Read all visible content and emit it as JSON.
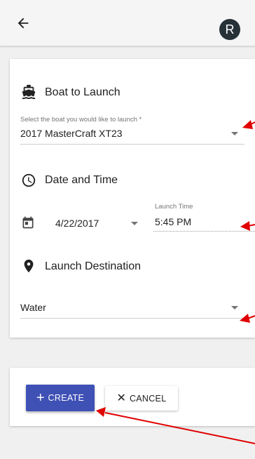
{
  "user": {
    "avatar_initial": "R"
  },
  "boat_section": {
    "title": "Boat to Launch",
    "label": "Select the boat you would like to launch *",
    "value": "2017 MasterCraft XT23"
  },
  "date_section": {
    "title": "Date and Time",
    "date_value": "4/22/2017",
    "time_label": "Launch Time",
    "time_value": "5:45 PM"
  },
  "destination_section": {
    "title": "Launch Destination",
    "value": "Water"
  },
  "actions": {
    "create_icon": "+",
    "create_label": "CREATE",
    "cancel_icon": "✕",
    "cancel_label": "CANCEL"
  },
  "colors": {
    "primary": "#3f51b5",
    "avatar": "#263238",
    "annotation_arrow": "#e00000"
  },
  "icons": [
    "back-arrow-icon",
    "boat-icon",
    "clock-icon",
    "calendar-icon",
    "location-pin-icon",
    "plus-icon",
    "close-icon"
  ]
}
